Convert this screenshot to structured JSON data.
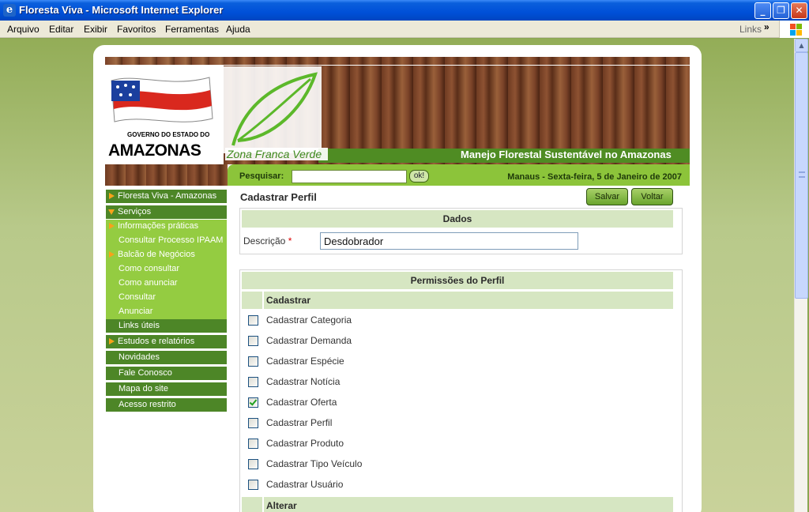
{
  "window": {
    "title": "Floresta Viva - Microsoft Internet Explorer"
  },
  "menubar": {
    "items": [
      "Arquivo",
      "Editar",
      "Exibir",
      "Favoritos",
      "Ferramentas",
      "Ajuda"
    ],
    "links": "Links"
  },
  "banner": {
    "gov_line1": "GOVERNO DO ESTADO DO",
    "gov_line2": "AMAZONAS",
    "zfv": "Zona Franca Verde",
    "tagline": "Manejo Florestal Sustentável no Amazonas"
  },
  "search": {
    "label": "Pesquisar:",
    "value": "",
    "ok": "ok!",
    "date": "Manaus - Sexta-feira, 5 de Janeiro de 2007"
  },
  "sidebar": {
    "items": [
      {
        "label": "Floresta Viva - Amazonas"
      },
      {
        "label": "Serviços"
      },
      {
        "label": "Informações práticas"
      },
      {
        "label": "Consultar Processo IPAAM"
      },
      {
        "label": "Balcão de Negócios"
      },
      {
        "label": "Como consultar"
      },
      {
        "label": "Como anunciar"
      },
      {
        "label": "Consultar"
      },
      {
        "label": "Anunciar"
      },
      {
        "label": "Links úteis"
      },
      {
        "label": "Estudos e relatórios"
      },
      {
        "label": "Novidades"
      },
      {
        "label": "Fale Conosco"
      },
      {
        "label": "Mapa do site"
      },
      {
        "label": "Acesso restrito"
      }
    ]
  },
  "main": {
    "title": "Cadastrar Perfil",
    "save": "Salvar",
    "back": "Voltar",
    "dados_header": "Dados",
    "desc_label": "Descrição",
    "required_mark": "*",
    "desc_value": "Desdobrador",
    "permissions_header": "Permissões do Perfil",
    "group1": "Cadastrar",
    "group2": "Alterar",
    "permissions": [
      {
        "label": "Cadastrar Categoria",
        "checked": false
      },
      {
        "label": "Cadastrar Demanda",
        "checked": false
      },
      {
        "label": "Cadastrar Espécie",
        "checked": false
      },
      {
        "label": "Cadastrar Notícia",
        "checked": false
      },
      {
        "label": "Cadastrar Oferta",
        "checked": true
      },
      {
        "label": "Cadastrar Perfil",
        "checked": false
      },
      {
        "label": "Cadastrar Produto",
        "checked": false
      },
      {
        "label": "Cadastrar Tipo Veículo",
        "checked": false
      },
      {
        "label": "Cadastrar Usuário",
        "checked": false
      }
    ]
  }
}
